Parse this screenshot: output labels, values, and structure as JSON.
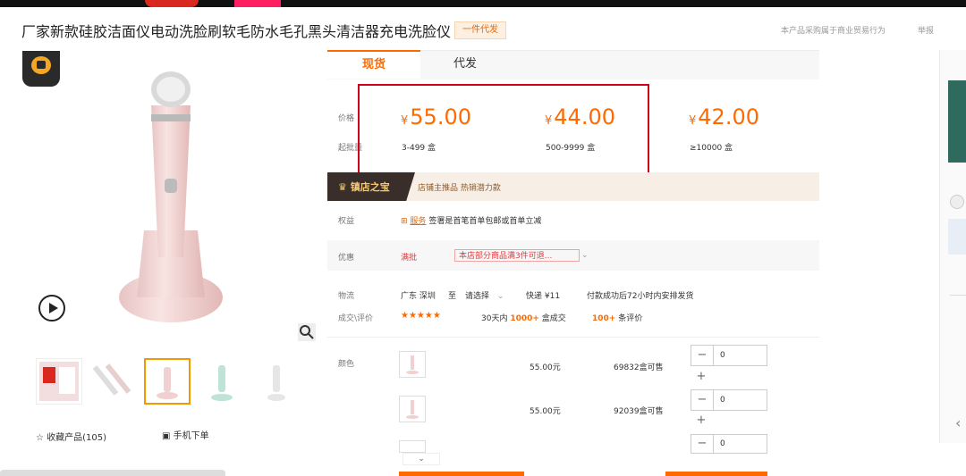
{
  "product": {
    "title": "厂家新款硅胶洁面仪电动洗脸刷软毛防水毛孔黑头清洁器充电洗脸仪",
    "badge": "一件代发",
    "notice": "本产品采购属于商业贸易行为",
    "report": "举报"
  },
  "tabs": [
    {
      "label": "现货",
      "active": true
    },
    {
      "label": "代发",
      "active": false
    }
  ],
  "pricing": {
    "price_label": "价格",
    "moq_label": "起批量",
    "currency": "¥",
    "tiers": [
      {
        "price": "55.00",
        "qty": "3-499 盒"
      },
      {
        "price": "44.00",
        "qty": "500-9999 盒"
      },
      {
        "price": "42.00",
        "qty": "≥10000 盒"
      }
    ]
  },
  "shop": {
    "name": "镇店之宝",
    "tags": "店铺主推品 热销潜力款"
  },
  "rights": {
    "label": "权益",
    "link": "服务",
    "text": "签署是首笔首单包邮或首单立减"
  },
  "offers": {
    "label": "优惠",
    "tag": "满批",
    "promo": "本店部分商品满3件可退..."
  },
  "logistics": {
    "label": "物流",
    "from": "广东 深圳",
    "to_word": "至",
    "dest": "请选择",
    "freight": "快递 ¥11",
    "ship": "付款成功后72小时内安排发货"
  },
  "reviews": {
    "label": "成交\\评价",
    "stars": "★★★★★",
    "sales_prefix": "30天内",
    "sales_count": "1000+",
    "sales_suffix": "盒成交",
    "review_count": "100+",
    "review_suffix": "条评价"
  },
  "variants": {
    "label": "颜色",
    "items": [
      {
        "price": "55.00元",
        "stock": "69832盒可售",
        "qty": "0"
      },
      {
        "price": "55.00元",
        "stock": "92039盒可售",
        "qty": "0"
      },
      {
        "price": "",
        "stock": "",
        "qty": "0"
      }
    ]
  },
  "actions": {
    "favorite": "收藏产品(105)",
    "mobile": "手机下单"
  },
  "icons": {
    "logo": "crown-logo-icon",
    "play": "play-icon",
    "zoom": "magnifier-icon",
    "star": "star-outline-icon",
    "qr": "qr-code-icon"
  },
  "colors": {
    "accent": "#ff6a00",
    "highlight": "#d0021b"
  }
}
